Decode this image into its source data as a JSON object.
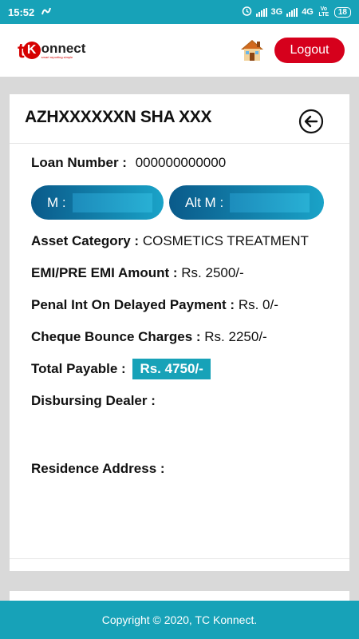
{
  "status_bar": {
    "time": "15:52",
    "network_3g": "3G",
    "network_4g": "4G",
    "volte": "Vo LTE",
    "battery": "18"
  },
  "header": {
    "logo_t": "t",
    "logo_k": "K",
    "logo_word": "onnect",
    "logo_tagline": "smart reporting simple",
    "logout_label": "Logout"
  },
  "card": {
    "title": "AZHXXXXXXN SHA XXX",
    "loan_number_label": "Loan Number :",
    "loan_number_value": "000000000000",
    "mobile_label": "M :",
    "alt_mobile_label": "Alt M :",
    "asset_category_label": "Asset Category :",
    "asset_category_value": "COSMETICS TREATMENT",
    "emi_label": "EMI/PRE EMI Amount :",
    "emi_value": "Rs. 2500/-",
    "penal_label": "Penal Int On Delayed Payment :",
    "penal_value": "Rs. 0/-",
    "cheque_label": "Cheque Bounce Charges :",
    "cheque_value": "Rs. 2250/-",
    "total_label": "Total Payable :",
    "total_value": "Rs. 4750/-",
    "dealer_label": "Disbursing Dealer :",
    "residence_label": "Residence Address :"
  },
  "footer": {
    "copyright": "Copyright © 2020, TC Konnect."
  },
  "colors": {
    "teal": "#17a2b8",
    "brand_red": "#d60000",
    "pill_dark": "#0a5a8a",
    "pill_light": "#1aa3c8"
  }
}
